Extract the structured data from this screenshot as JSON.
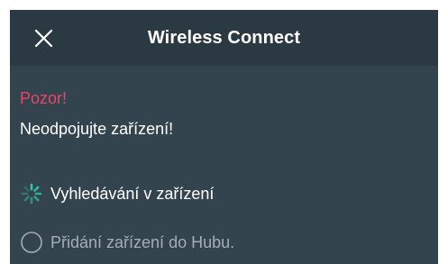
{
  "header": {
    "title": "Wireless Connect",
    "close_icon": "close-icon"
  },
  "warning": {
    "title": "Pozor!",
    "text": "Neodpojujte zařízení!",
    "title_color": "#e5476a"
  },
  "steps": [
    {
      "label": "Vyhledávání v zařízení",
      "icon": "spinner-icon",
      "state": "in-progress"
    },
    {
      "label": "Přidání zařízení do Hubu.",
      "icon": "empty-circle-icon",
      "state": "pending"
    }
  ],
  "colors": {
    "background": "#33444e",
    "header": "#2b3942",
    "accent": "#34c6a1",
    "pending_text": "#a4aeb4"
  }
}
